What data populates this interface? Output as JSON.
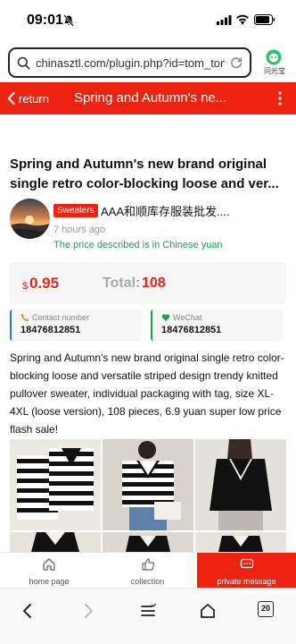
{
  "status_bar": {
    "time": "09:01"
  },
  "address_bar": {
    "url": "chinasztl.com/plugin.php?id=tom_tongch...",
    "assistant_label": "问元宝"
  },
  "header": {
    "back_label": "return",
    "title": "Spring and Autumn's ne..."
  },
  "product": {
    "title": "Spring and Autumn's new brand original single retro color-blocking loose and ver...",
    "category": "Sweaters",
    "shop_name": "AAA和顺库存服装批发....",
    "posted_time": "7 hours ago",
    "price_note": "The price described is in Chinese yuan",
    "currency_symbol": "$",
    "price": "0.95",
    "total_label": "Total:",
    "total_value": "108",
    "description": "Spring and Autumn's new brand original single retro color-blocking loose and versatile striped design trendy knitted pullover sweater, individual packaging with tag, size XL- 4XL (loose version), 108 pieces, 6.9 yuan super low price flash sale!"
  },
  "contact": {
    "phone_label": "Contact number",
    "phone_value": "18476812851",
    "wechat_label": "WeChat",
    "wechat_value": "18476812851"
  },
  "photos": [
    "striped-sweater-photo",
    "striped-vneck-sweater-photo",
    "black-vneck-sweater-photo"
  ],
  "action_bar": {
    "home_label": "home page",
    "collection_label": "collection",
    "message_label": "private message"
  },
  "browser_nav": {
    "tabs_count": "20"
  },
  "colors": {
    "brand_red": "#ee2211",
    "price_note_green": "#1aa34a"
  }
}
